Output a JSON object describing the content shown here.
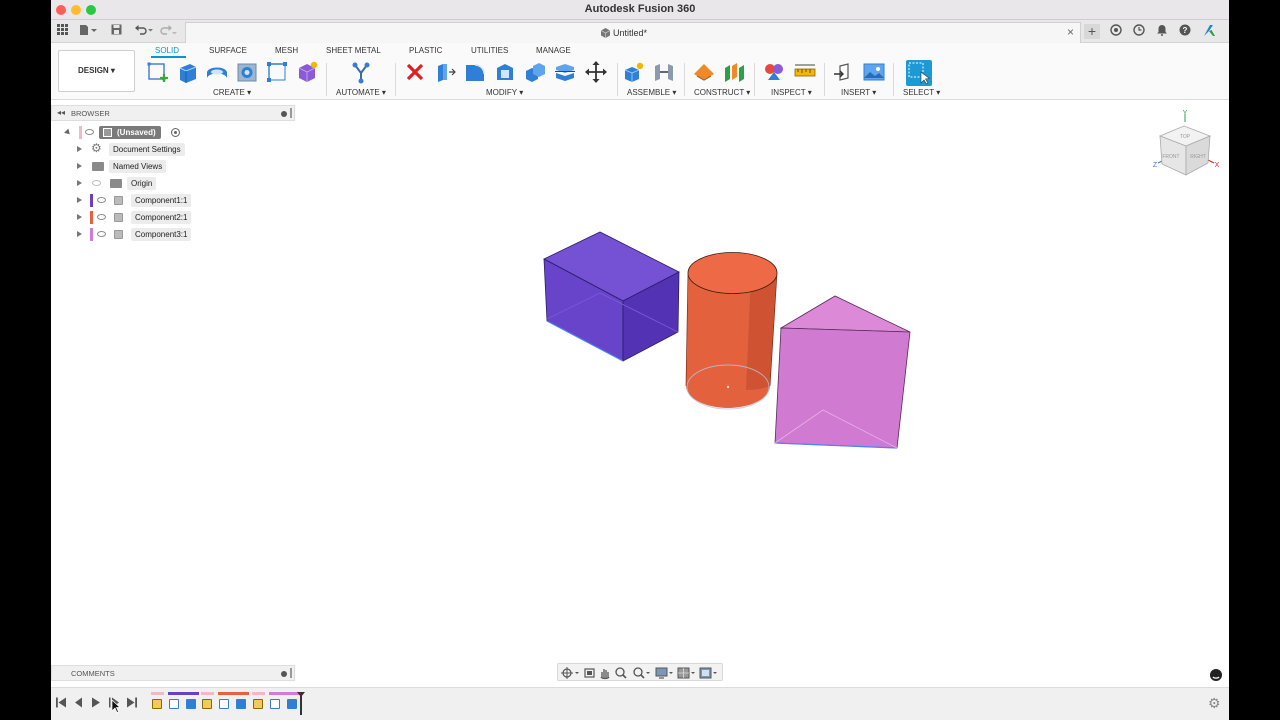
{
  "window": {
    "title": "Autodesk Fusion 360"
  },
  "tab": {
    "label": "Untitled*"
  },
  "workspace": {
    "label": "DESIGN ▾"
  },
  "ribbon": {
    "tabs": [
      "SOLID",
      "SURFACE",
      "MESH",
      "SHEET METAL",
      "PLASTIC",
      "UTILITIES",
      "MANAGE"
    ],
    "active_tab": "SOLID",
    "groups": [
      "CREATE ▾",
      "AUTOMATE ▾",
      "MODIFY ▾",
      "ASSEMBLE ▾",
      "CONSTRUCT ▾",
      "INSPECT ▾",
      "INSERT ▾",
      "SELECT ▾"
    ]
  },
  "browser": {
    "title": "BROWSER",
    "root": "(Unsaved)",
    "items": [
      {
        "label": "Document Settings",
        "icon": "gear-icon"
      },
      {
        "label": "Named Views",
        "icon": "folder-icon"
      },
      {
        "label": "Origin",
        "icon": "folder-icon"
      },
      {
        "label": "Component1:1",
        "color": "#6a3fc8"
      },
      {
        "label": "Component2:1",
        "color": "#e6613f"
      },
      {
        "label": "Component3:1",
        "color": "#d27bd6"
      }
    ]
  },
  "viewcube": {
    "faces": [
      "TOP",
      "FRONT",
      "RIGHT"
    ],
    "axes": [
      "Y",
      "Z",
      "X"
    ]
  },
  "comments": {
    "title": "COMMENTS"
  },
  "colors": {
    "accent": "#0696d7",
    "box": "#5f36c9",
    "cylinder": "#e8623e",
    "prism": "#d77bd8"
  }
}
